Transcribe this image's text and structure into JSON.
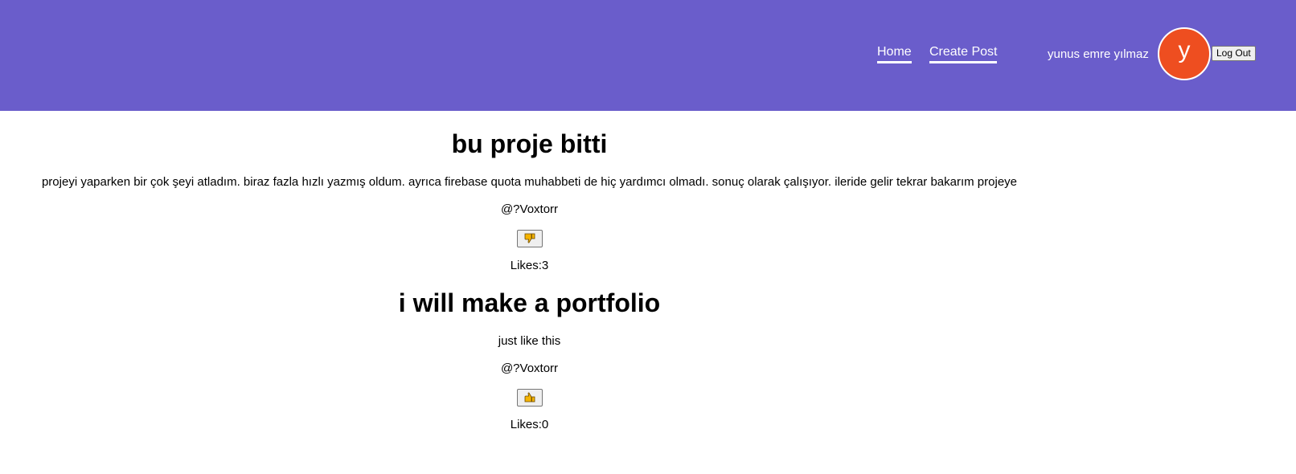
{
  "nav": {
    "home_label": "Home",
    "create_post_label": "Create Post",
    "username": "yunus emre yılmaz",
    "avatar_initial": "y",
    "logout_label": "Log Out",
    "colors": {
      "navbar_bg": "#6a5dcb",
      "avatar_bg": "#ee4e20"
    }
  },
  "posts": [
    {
      "title": "bu proje bitti",
      "body": "projeyi yaparken bir çok şeyi atladım. biraz fazla hızlı yazmış oldum. ayrıca firebase quota muhabbeti de hiç yardımcı olmadı. sonuç olarak çalışıyor. ileride gelir tekrar bakarım projeye",
      "author": "@?Voxtorr",
      "like_icon": "thumbs-down-icon",
      "likes": "Likes:3"
    },
    {
      "title": "i will make a portfolio",
      "body": "just like this",
      "author": "@?Voxtorr",
      "like_icon": "thumbs-up-icon",
      "likes": "Likes:0"
    }
  ]
}
